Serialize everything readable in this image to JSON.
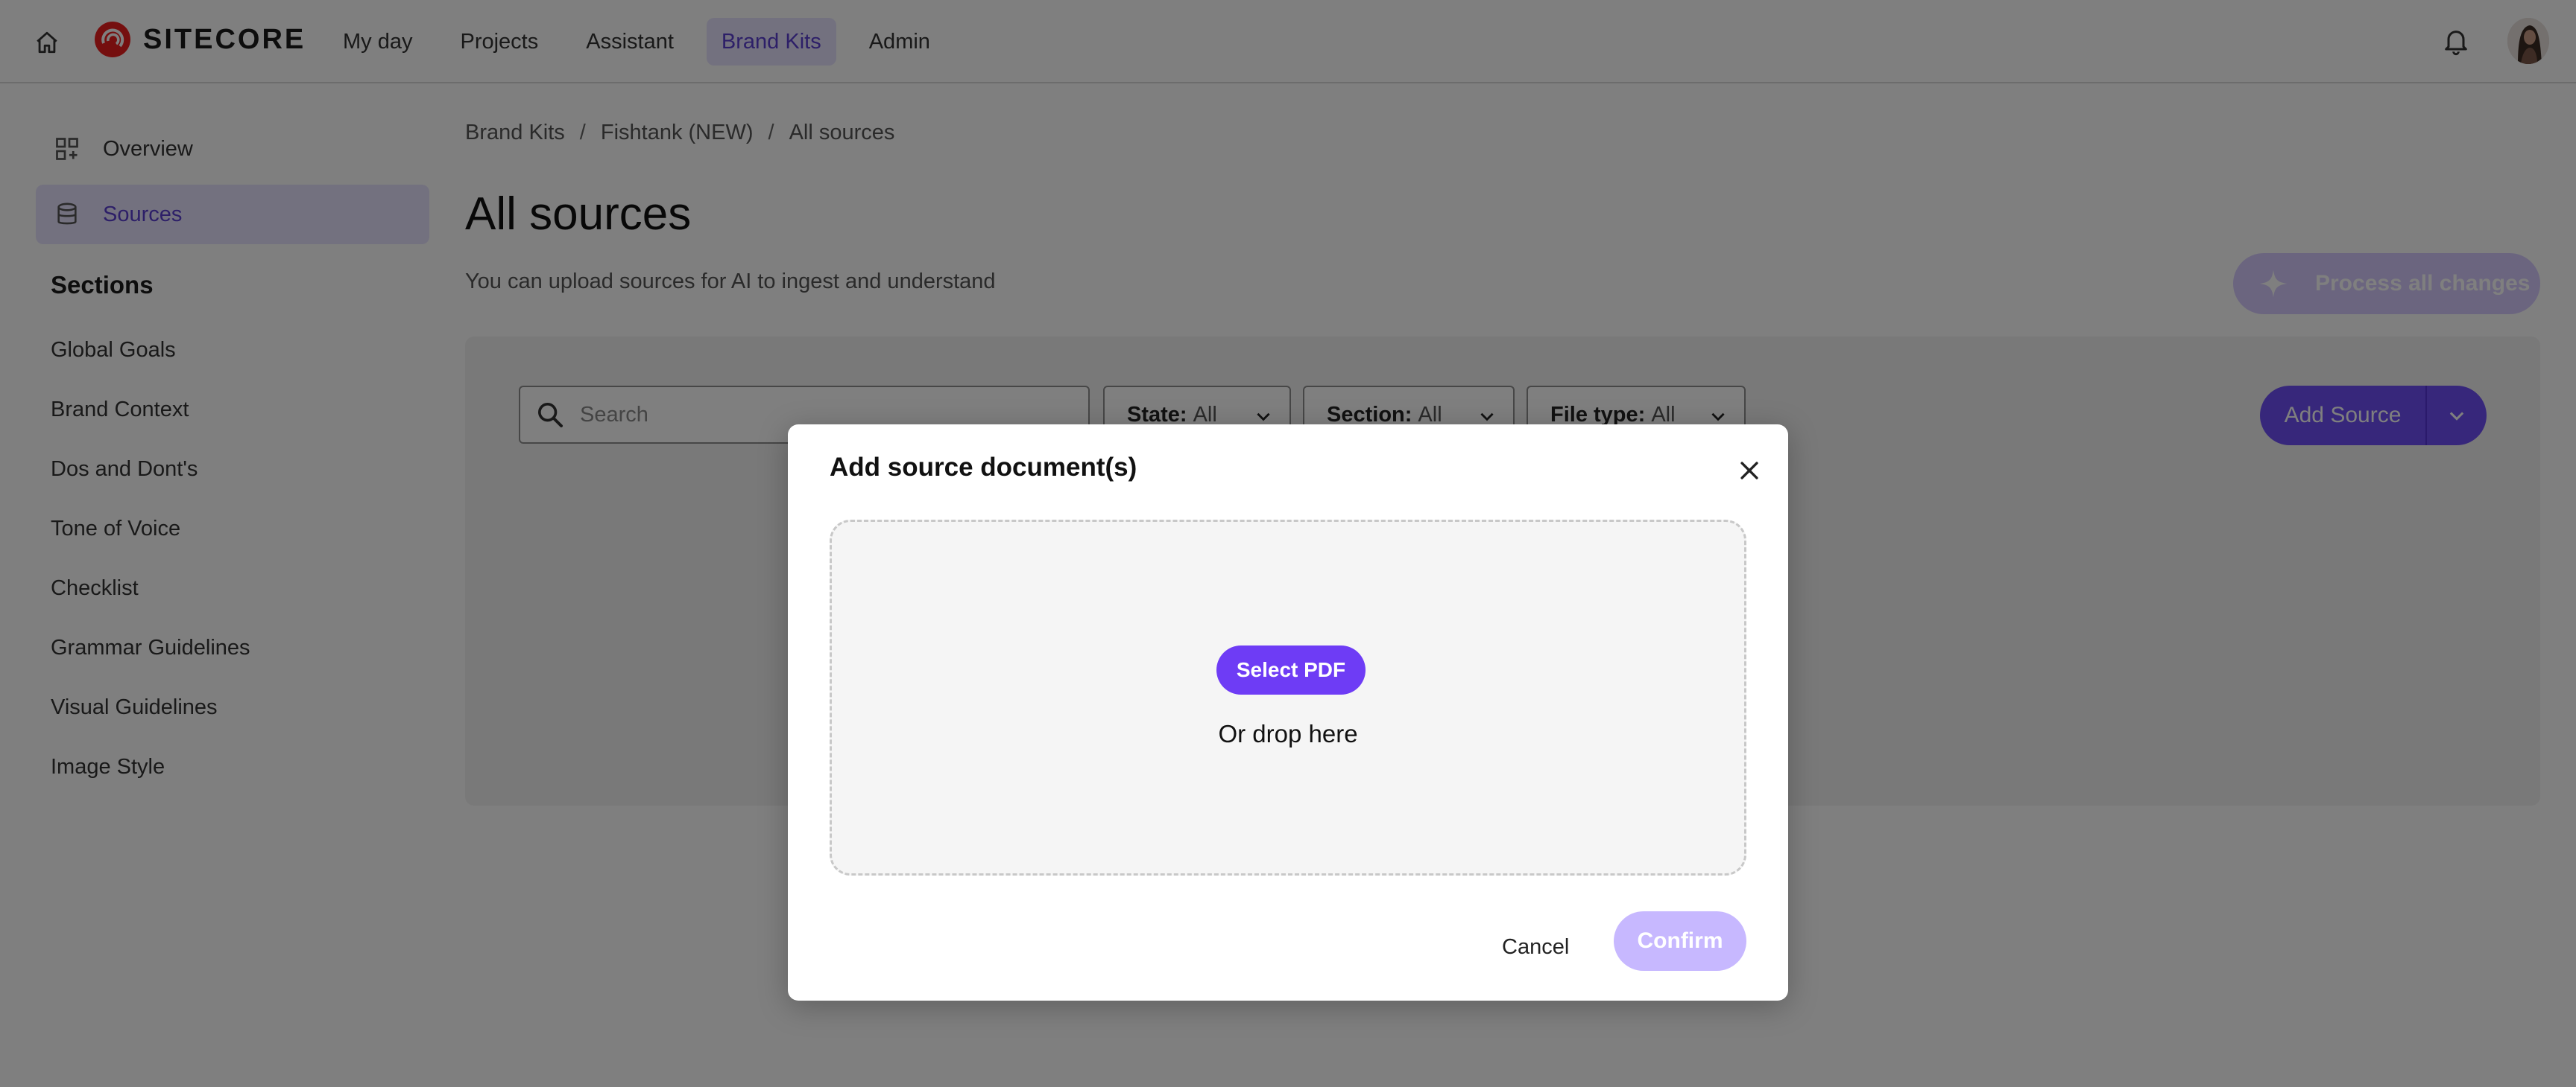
{
  "brand": {
    "name": "SITECORE"
  },
  "nav": {
    "items": [
      {
        "label": "My day"
      },
      {
        "label": "Projects"
      },
      {
        "label": "Assistant"
      },
      {
        "label": "Brand Kits",
        "active": true
      },
      {
        "label": "Admin"
      }
    ]
  },
  "sidebar": {
    "items": [
      {
        "label": "Overview",
        "icon": "dashboard-icon"
      },
      {
        "label": "Sources",
        "icon": "database-icon",
        "active": true
      }
    ],
    "sections_heading": "Sections",
    "sections": [
      {
        "label": "Global Goals"
      },
      {
        "label": "Brand Context"
      },
      {
        "label": "Dos and Dont's"
      },
      {
        "label": "Tone of Voice"
      },
      {
        "label": "Checklist"
      },
      {
        "label": "Grammar Guidelines"
      },
      {
        "label": "Visual Guidelines"
      },
      {
        "label": "Image Style"
      }
    ]
  },
  "breadcrumb": [
    "Brand Kits",
    "Fishtank (NEW)",
    "All sources"
  ],
  "breadcrumb_separator": "/",
  "page": {
    "title": "All sources",
    "subtitle": "You can upload sources for AI to ingest and understand",
    "process_button": "Process all changes"
  },
  "toolbar": {
    "search_placeholder": "Search",
    "filters": [
      {
        "key": "State:",
        "value": "All"
      },
      {
        "key": "Section:",
        "value": "All"
      },
      {
        "key": "File type:",
        "value": "All"
      }
    ],
    "add_source": "Add Source"
  },
  "modal": {
    "title": "Add source document(s)",
    "select_button": "Select PDF",
    "drop_text": "Or drop here",
    "cancel": "Cancel",
    "confirm": "Confirm"
  },
  "colors": {
    "accent": "#6e4ff6",
    "accent_light": "#e7e3ff",
    "brand_red": "#eb1f1f"
  }
}
